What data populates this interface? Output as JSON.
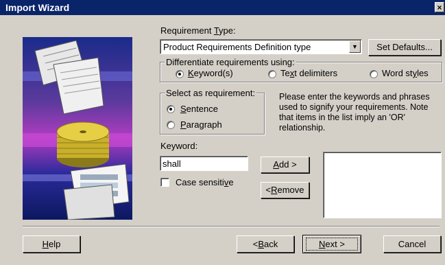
{
  "window": {
    "title": "Import Wizard",
    "close_glyph": "×"
  },
  "requirement_type": {
    "label_pre": "Requirement ",
    "label_u": "T",
    "label_post": "ype:",
    "selected": "Product Requirements Definition type",
    "dropdown_arrow": "▼",
    "set_defaults": "Set Defaults..."
  },
  "differentiate": {
    "label": "Differentiate requirements using:",
    "options": [
      {
        "u": "K",
        "rest": "eyword(s)",
        "pre": "",
        "checked": true
      },
      {
        "pre": "Te",
        "u": "x",
        "rest": "t delimiters",
        "checked": false
      },
      {
        "pre": "Word st",
        "u": "y",
        "rest": "les",
        "checked": false
      }
    ]
  },
  "select_as": {
    "label": "Select as requirement:",
    "options": [
      {
        "u": "S",
        "rest": "entence",
        "checked": true
      },
      {
        "u": "P",
        "rest": "aragraph",
        "checked": false
      }
    ]
  },
  "instructions": "Please enter the keywords and phrases used to signify your requirements. Note that items in the list imply an 'OR' relationship.",
  "keyword": {
    "label": "Keyword:",
    "value": "shall",
    "case_sensitive_pre": "Case sensiti",
    "case_sensitive_u": "v",
    "case_sensitive_post": "e",
    "case_sensitive_checked": false
  },
  "buttons": {
    "add_u": "A",
    "add_rest": "dd >",
    "remove_pre": "< ",
    "remove_u": "R",
    "remove_rest": "emove",
    "help_u": "H",
    "help_rest": "elp",
    "back_pre": "< ",
    "back_u": "B",
    "back_rest": "ack",
    "next_u": "N",
    "next_rest": "ext >",
    "cancel": "Cancel"
  },
  "keyword_list": [],
  "colors": {
    "title_bar": "#0a246a",
    "face": "#d4d0c8"
  }
}
